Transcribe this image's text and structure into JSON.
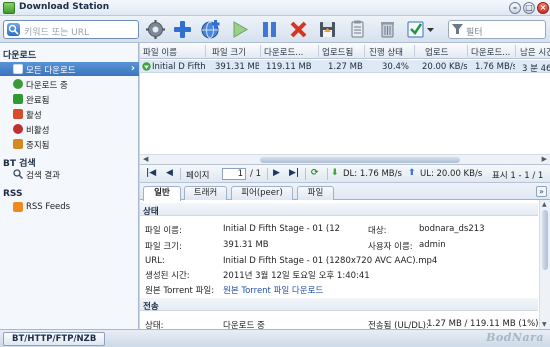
{
  "window": {
    "title": "Download Station",
    "minimize": "–",
    "maximize": "□",
    "close": "×"
  },
  "toolbar": {
    "search_placeholder": "키워드 또는 URL",
    "filter_placeholder": "필터",
    "buttons": [
      "settings-icon",
      "add-icon",
      "add-url-icon",
      "resume-icon",
      "pause-icon",
      "delete-icon",
      "save-icon",
      "clear-icon",
      "select-icon"
    ]
  },
  "sidebar": {
    "download_title": "다운로드",
    "download_items": [
      {
        "label": "모든 다운로드",
        "icon": "all-downloads-icon",
        "color": "#4a7fc1",
        "selected": true
      },
      {
        "label": "다운로드 중",
        "icon": "downloading-icon",
        "color": "#3a9a3a"
      },
      {
        "label": "완료됨",
        "icon": "completed-icon",
        "color": "#2f9a2f"
      },
      {
        "label": "활성",
        "icon": "active-icon",
        "color": "#d94a2b"
      },
      {
        "label": "비활성",
        "icon": "inactive-icon",
        "color": "#c03030"
      },
      {
        "label": "중지됨",
        "icon": "stopped-icon",
        "color": "#d28a1e"
      }
    ],
    "bt_title": "BT 검색",
    "bt_items": [
      {
        "label": "검색 결과",
        "icon": "search-result-icon"
      }
    ],
    "rss_title": "RSS",
    "rss_items": [
      {
        "label": "RSS Feeds",
        "icon": "rss-icon",
        "color": "#ef8a1f"
      }
    ]
  },
  "list": {
    "columns": [
      "파일 이름",
      "파일 크기",
      "다운로드...",
      "업로드됨",
      "진행 상태",
      "업로드",
      "다운로드...",
      "남은 시간"
    ],
    "rows": [
      {
        "name": "Initial D Fifth ...",
        "size": "391.31 MB",
        "downloaded": "119.11 MB",
        "uploaded": "1.27 MB",
        "progress": "30.4%",
        "upload_speed": "20.00 KB/s",
        "download_speed": "1.76 MB/s",
        "remaining": "3 분 46 초"
      }
    ]
  },
  "pager": {
    "page_label": "페이지",
    "page_value": "1",
    "page_total": "/ 1",
    "dl": "DL: 1.76 MB/s",
    "ul": "UL: 20.00 KB/s",
    "display": "표시 1 - 1 / 1"
  },
  "details": {
    "tabs": [
      "일반",
      "트래커",
      "피어(peer)",
      "파일"
    ],
    "status_title": "상태",
    "filename_label": "파일 이름:",
    "filename_value": "Initial D Fifth Stage - 01 (12",
    "dest_label": "대상:",
    "dest_value": "bodnara_ds213",
    "size_label": "파일 크기:",
    "size_value": "391.31 MB",
    "user_label": "사용자 이름:",
    "user_value": "admin",
    "url_label": "URL:",
    "url_value": "Initial D Fifth Stage - 01 (1280x720 AVC AAC).mp4",
    "created_label": "생성된 시간:",
    "created_value": "2011년 3월 12일 토요일 오후 1:40:41",
    "torrent_label": "원본 Torrent 파일:",
    "torrent_value": "원본 Torrent 파일 다운로드",
    "transfer_title": "전송",
    "state_label": "상태:",
    "state_value": "다운로드 중",
    "transferred_label": "전송됨 (UL/DL):",
    "transferred_value": "1.27 MB / 119.11 MB (1%)"
  },
  "statusbar": {
    "tab_label": "BT/HTTP/FTP/NZB",
    "watermark": "BodNara"
  }
}
